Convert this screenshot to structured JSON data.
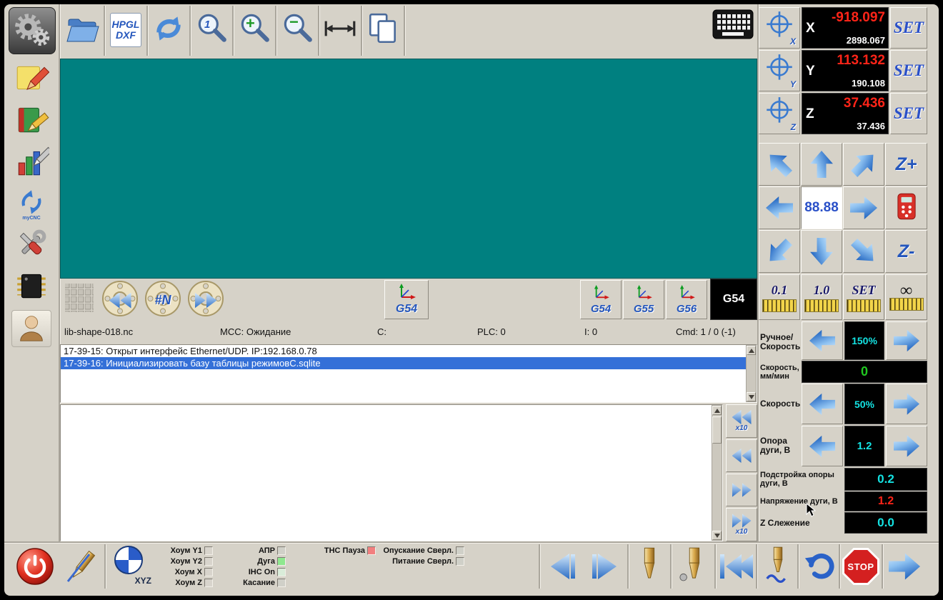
{
  "colors": {
    "canvas": "#008080",
    "panel": "#d6d2c8",
    "value_red": "#ff2418",
    "value_teal": "#14e2e2",
    "value_green": "#20c820",
    "selection_blue": "#3470d8",
    "accent_blue": "#2a62c0"
  },
  "icons": {
    "sidebar": [
      "gears",
      "note-pencil",
      "book",
      "stats-pencil",
      "mycnc-sync",
      "tools",
      "chip",
      "user"
    ],
    "toolbar": [
      "open-folder",
      "hpgl-dxf-page",
      "refresh",
      "zoom-actual",
      "zoom-in",
      "zoom-out",
      "fit-width",
      "pages",
      "keyboard"
    ],
    "misc": [
      "crosshair",
      "washer",
      "grid",
      "pendant-remote",
      "power",
      "probe-pen",
      "drill-bit",
      "stop-octagon",
      "undo-arrow",
      "mouse-cursor"
    ]
  },
  "sidebar": {
    "logo_text": "myCNC"
  },
  "toolbar": {
    "hpgl": "HPGL",
    "dxf": "DXF",
    "zoom_one": "1",
    "zoom_in": "+",
    "zoom_out": "−"
  },
  "dro": {
    "axes": [
      {
        "axis": "X",
        "value": "-918.097",
        "sub": "2898.067",
        "set_label": "SET"
      },
      {
        "axis": "Y",
        "value": "113.132",
        "sub": "190.108",
        "set_label": "SET"
      },
      {
        "axis": "Z",
        "value": "37.436",
        "sub": "37.436",
        "set_label": "SET"
      }
    ]
  },
  "jog": {
    "center_value": "88.88",
    "z_plus": "Z+",
    "z_minus": "Z-"
  },
  "steps": [
    {
      "label": "0.1"
    },
    {
      "label": "1.0"
    },
    {
      "label": "SET"
    },
    {
      "label": "∞"
    }
  ],
  "overrides": {
    "manual": {
      "label1": "Ручное/",
      "label2": "Скорость",
      "value": "150%"
    },
    "feed": {
      "label1": "Скорость,",
      "label2": "мм/мин",
      "value": "0"
    },
    "speed": {
      "label": "Скорость",
      "value": "50%"
    },
    "arc_ref": {
      "label1": "Опора",
      "label2": "дуги, В",
      "value": "1.2"
    },
    "arc_adj": {
      "label1": "Подстройка опоры",
      "label2": "дуги, В",
      "value": "0.2"
    },
    "arc_voltage": {
      "label": "Напряжение дуги, В",
      "value": "1.2"
    },
    "z_tracking": {
      "label": "Z Слежение",
      "value": "0.0"
    }
  },
  "gcode_bar": {
    "line_number": "#N",
    "wcs_main": "G54",
    "wcs": [
      {
        "label": "G54"
      },
      {
        "label": "G55"
      },
      {
        "label": "G56"
      }
    ],
    "active_wcs": "G54"
  },
  "status": {
    "file": "lib-shape-018.nc",
    "mcc": "MCC: Ожидание",
    "c": "C:",
    "plc": "PLC: 0",
    "i": "I: 0",
    "cmd": "Cmd: 1 / 0 (-1)"
  },
  "log": {
    "lines": [
      {
        "text": "17-39-15: Открыт интерфейс Ethernet/UDP. IP:192.168.0.78"
      },
      {
        "text": "17-39-16: Инициализировать базу таблицы режимовC.sqlite"
      }
    ]
  },
  "scroll": {
    "x10": "x10"
  },
  "bottom": {
    "xyz": "XYZ",
    "home": [
      {
        "label": "Хоум Y1",
        "led": "#d8d4cc"
      },
      {
        "label": "Хоум Y2",
        "led": "#d8d4cc"
      },
      {
        "label": "Хоум X",
        "led": "#d8d4cc"
      },
      {
        "label": "Хоум Z",
        "led": "#d8d4cc"
      }
    ],
    "switches": [
      {
        "label": "АПР",
        "led": "#d0d0c8"
      },
      {
        "label": "Дуга",
        "led": "#8fe88f"
      },
      {
        "label": "IHC On",
        "led": "#d9ecd9"
      },
      {
        "label": "Касание",
        "led": "#d0d0c8"
      }
    ],
    "thc_pause": {
      "label": "THC Пауза",
      "led": "#f27f7f"
    },
    "drill_lower": {
      "label": "Опускание Сверл.",
      "led": "#d0d0c8"
    },
    "drill_power": {
      "label": "Питание Сверл.",
      "led": "#d0d0c8"
    },
    "stop": "STOP"
  }
}
